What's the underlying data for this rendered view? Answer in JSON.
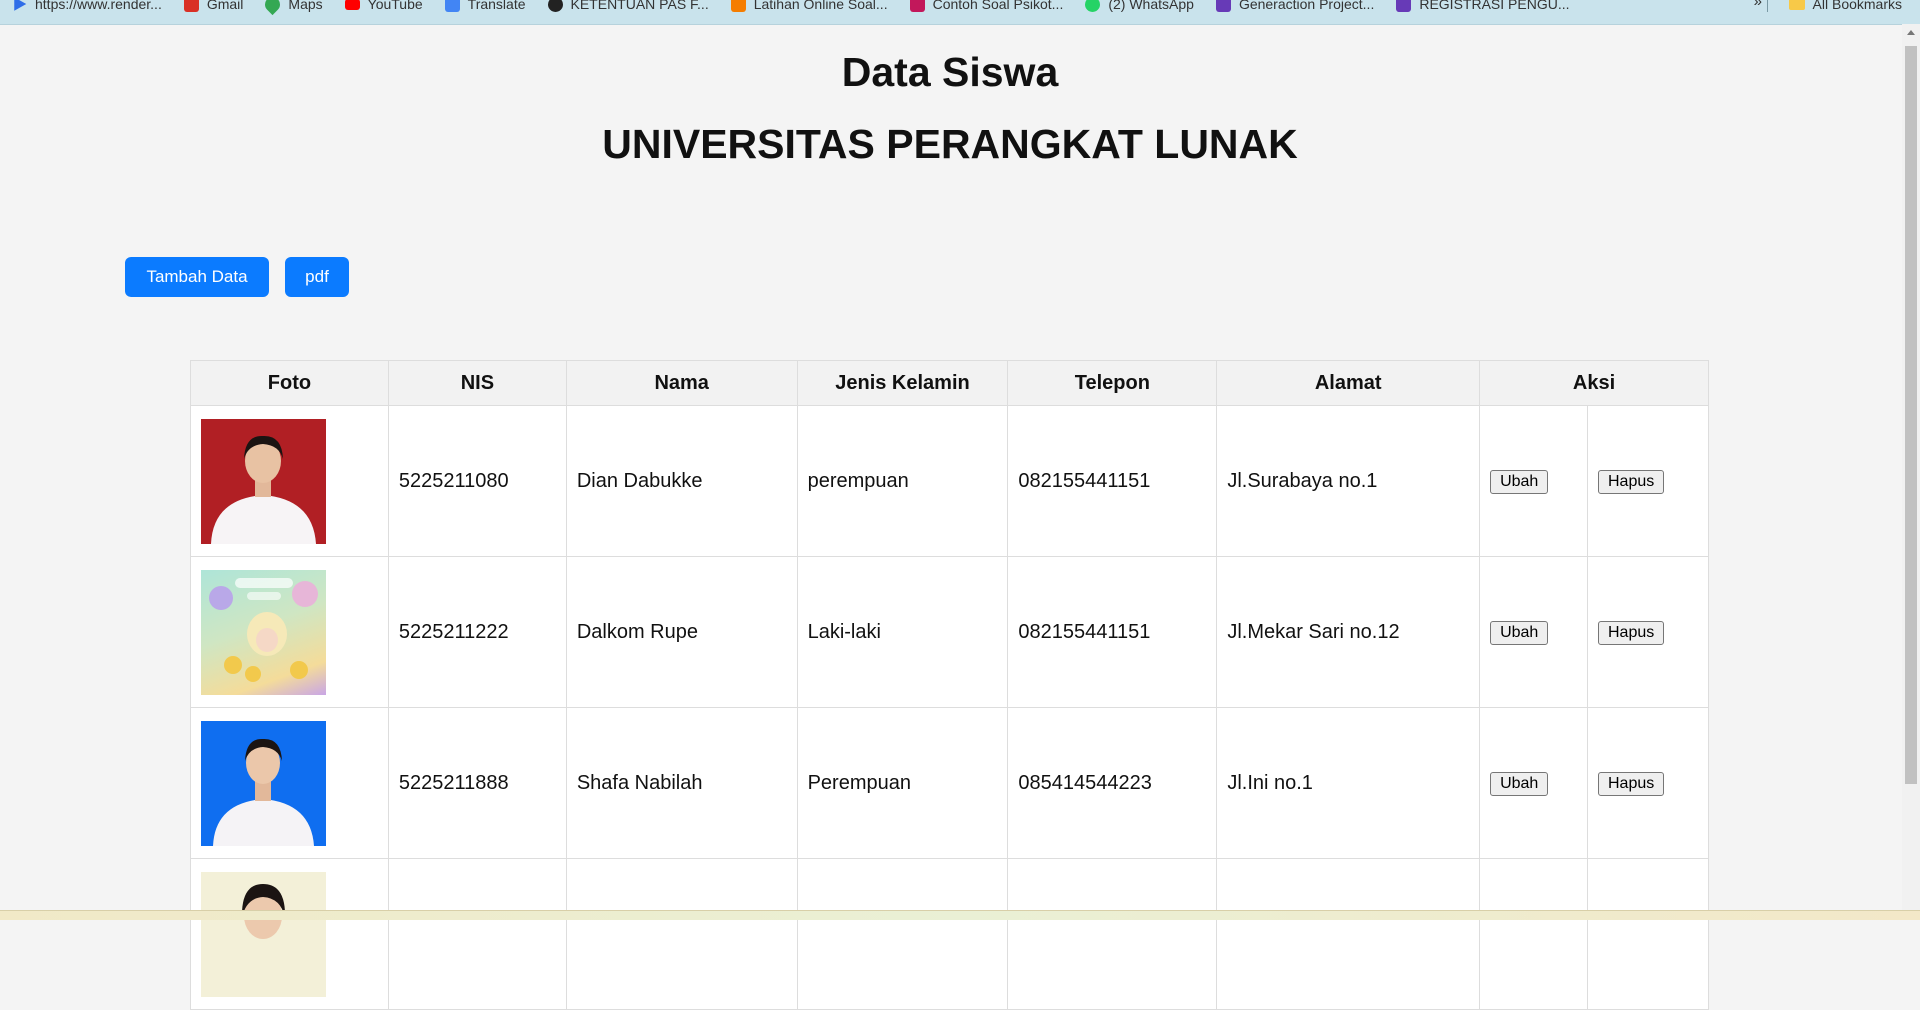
{
  "bookmarks": {
    "items": [
      {
        "label": "https://www.render...",
        "icon": "play-icon",
        "color": "#2f6ee8"
      },
      {
        "label": "Gmail",
        "icon": "gmail-icon",
        "color": "#d93025"
      },
      {
        "label": "Maps",
        "icon": "maps-pin-icon",
        "color": "#34a853"
      },
      {
        "label": "YouTube",
        "icon": "youtube-icon",
        "color": "#ff0000"
      },
      {
        "label": "Translate",
        "icon": "translate-icon",
        "color": "#4285f4"
      },
      {
        "label": "KETENTUAN PAS F...",
        "icon": "clock-icon",
        "color": "#222222"
      },
      {
        "label": "Latihan Online Soal...",
        "icon": "blogger-icon",
        "color": "#f57d00"
      },
      {
        "label": "Contoh Soal Psikot...",
        "icon": "psikotes-icon",
        "color": "#c2185b"
      },
      {
        "label": "(2) WhatsApp",
        "icon": "whatsapp-icon",
        "color": "#25d366"
      },
      {
        "label": "Generaction Project...",
        "icon": "forms-icon",
        "color": "#673ab7"
      },
      {
        "label": "REGISTRASI PENGU...",
        "icon": "forms-icon",
        "color": "#673ab7"
      }
    ],
    "more": "»",
    "all_bookmarks": "All Bookmarks"
  },
  "page": {
    "title": "Data Siswa",
    "subtitle": "UNIVERSITAS PERANGKAT LUNAK"
  },
  "toolbar": {
    "add_label": "Tambah Data",
    "pdf_label": "pdf",
    "accent": "#0b7bff"
  },
  "table": {
    "headers": [
      "Foto",
      "NIS",
      "Nama",
      "Jenis Kelamin",
      "Telepon",
      "Alamat",
      "Aksi"
    ],
    "rows": [
      {
        "nis": "5225211080",
        "nama": "Dian Dabukke",
        "jk": "perempuan",
        "telepon": "082155441151",
        "alamat": "Jl.Surabaya no.1",
        "edit": "Ubah",
        "delete": "Hapus",
        "photo_bg": "#b11f24"
      },
      {
        "nis": "5225211222",
        "nama": "Dalkom Rupe",
        "jk": "Laki-laki",
        "telepon": "082155441151",
        "alamat": "Jl.Mekar Sari no.12",
        "edit": "Ubah",
        "delete": "Hapus",
        "photo_bg": "illustration"
      },
      {
        "nis": "5225211888",
        "nama": "Shafa Nabilah",
        "jk": "Perempuan",
        "telepon": "085414544223",
        "alamat": "Jl.Ini no.1",
        "edit": "Ubah",
        "delete": "Hapus",
        "photo_bg": "#0f6ef0"
      }
    ]
  }
}
